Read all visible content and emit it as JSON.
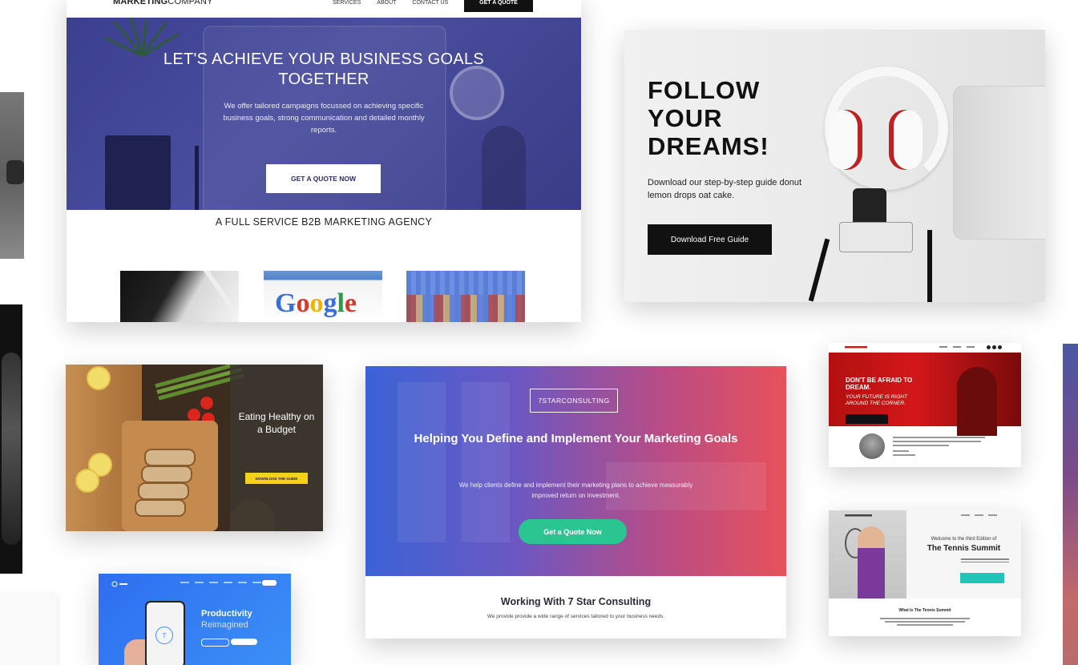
{
  "marketing": {
    "logo_bold": "MARKETING",
    "logo_light": "COMPANY",
    "nav": [
      "SERVICES",
      "ABOUT",
      "CONTACT US"
    ],
    "nav_cta": "GET A QUOTE",
    "headline": "LET'S ACHIEVE YOUR BUSINESS GOALS TOGETHER",
    "subtext": "We offer tailored campaigns focussed on achieving specific business goals, strong communication and detailed monthly reports.",
    "cta": "GET A QUOTE NOW",
    "section_title": "A FULL SERVICE B2B MARKETING AGENCY",
    "thumb_google": "Google"
  },
  "dreams": {
    "title": "FOLLOW YOUR DREAMS!",
    "body": "Download our step-by-step guide donut lemon drops oat cake.",
    "cta": "Download Free Guide"
  },
  "healthy": {
    "title": "Eating Healthy on a Budget",
    "cta": "DOWNLOAD THE GUIDE"
  },
  "consulting": {
    "brand": "7STARCONSULTING",
    "headline": "Helping You Define and Implement Your Marketing Goals",
    "subtext": "We help clients define and implement their marketing plans to achieve measurably improved return on investment.",
    "cta": "Get a Quote Now",
    "section_title": "Working With 7 Star Consulting",
    "section_sub": "We provide provide a wide range of services tailored to your business needs."
  },
  "productivity": {
    "headline": "Productivity",
    "subheadline": "Reimagined"
  },
  "afraid": {
    "headline": "DON'T BE AFRAID TO DREAM.",
    "subtext": "YOUR FUTURE IS RIGHT AROUND THE CORNER."
  },
  "tennis": {
    "welcome": "Welcome to the third Edition of",
    "title": "The Tennis Summit",
    "section_title": "What Is The Tennis Summit"
  },
  "colors": {
    "marketing_hero": "#3c3f8f",
    "consulting_cta": "#2ac591",
    "healthy_cta": "#f6d11a",
    "afraid_hero": "#d3171a",
    "tennis_cta": "#22c3b8",
    "productivity_bg": "#2d6ef0"
  }
}
